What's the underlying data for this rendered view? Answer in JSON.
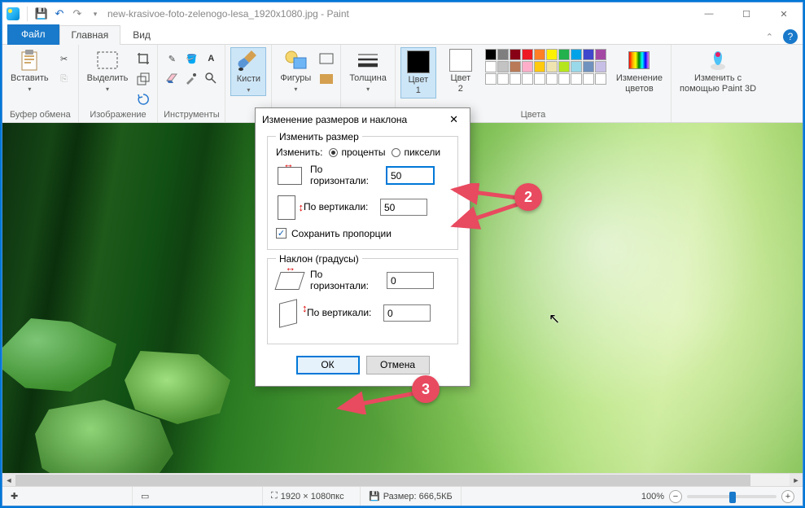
{
  "titlebar": {
    "filename": "new-krasivoe-foto-zelenogo-lesa_1920x1080.jpg - Paint",
    "save_icon": "💾",
    "undo_icon": "↶",
    "redo_icon": "↷",
    "dd_icon": "▾",
    "min": "—",
    "max": "☐",
    "close": "✕"
  },
  "tabs": {
    "file": "Файл",
    "home": "Главная",
    "view": "Вид",
    "collapse": "⌃",
    "help": "?"
  },
  "ribbon": {
    "clipboard_label": "Буфер обмена",
    "paste": "Вставить",
    "image_label": "Изображение",
    "select": "Выделить",
    "tools_label": "Инструменты",
    "brushes": "Кисти",
    "shapes_label": "Фигуры",
    "shapes": "Фигуры",
    "size": "Толщина",
    "colors_label": "Цвета",
    "color1": "Цвет\n1",
    "color2": "Цвет\n2",
    "edit_colors": "Изменение\nцветов",
    "paint3d": "Изменить с\nпомощью Paint 3D"
  },
  "colors": {
    "row1": [
      "#000000",
      "#7f7f7f",
      "#880015",
      "#ed1c24",
      "#ff7f27",
      "#fff200",
      "#22b14c",
      "#00a2e8",
      "#3f48cc",
      "#a349a4"
    ],
    "row2": [
      "#ffffff",
      "#c3c3c3",
      "#b97a57",
      "#ffaec9",
      "#ffc90e",
      "#efe4b0",
      "#b5e61d",
      "#99d9ea",
      "#7092be",
      "#c8bfe7"
    ],
    "row3": [
      "#ffffff",
      "#ffffff",
      "#ffffff",
      "#ffffff",
      "#ffffff",
      "#ffffff",
      "#ffffff",
      "#ffffff",
      "#ffffff",
      "#ffffff"
    ],
    "current1": "#000000",
    "current2": "#ffffff"
  },
  "dialog": {
    "title": "Изменение размеров и наклона",
    "close": "✕",
    "resize_legend": "Изменить размер",
    "resize_by": "Изменить:",
    "percent": "проценты",
    "pixels": "пиксели",
    "horizontal": "По горизонтали:",
    "vertical": "По вертикали:",
    "h_value": "50",
    "v_value": "50",
    "keep_aspect": "Сохранить пропорции",
    "check": "✓",
    "skew_legend": "Наклон (градусы)",
    "skew_h": "0",
    "skew_v": "0",
    "ok": "ОК",
    "cancel": "Отмена"
  },
  "status": {
    "pos_icon": "✚",
    "sel_icon": "▭",
    "dims_icon": "⛶",
    "dims": "1920 × 1080пкс",
    "size_icon": "💾",
    "size": "Размер: 666,5КБ",
    "zoom": "100%",
    "minus": "−",
    "plus": "+"
  },
  "callouts": {
    "two": "2",
    "three": "3"
  }
}
